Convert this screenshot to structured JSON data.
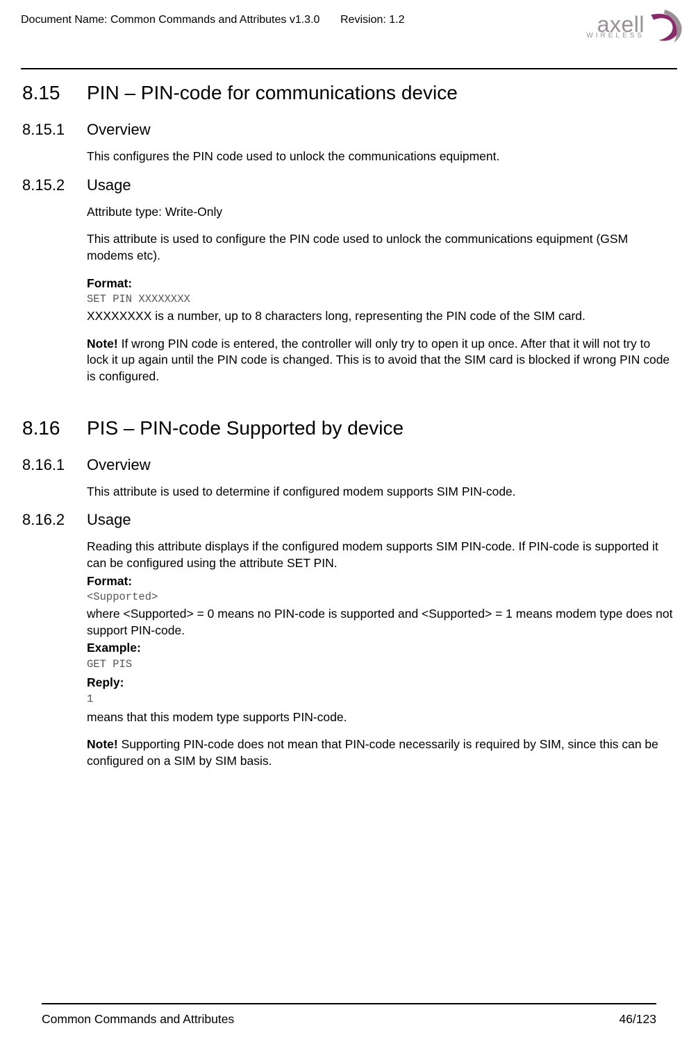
{
  "header": {
    "doc_name": "Document Name: Common Commands and Attributes v1.3.0",
    "revision": "Revision: 1.2",
    "logo_main": "axell",
    "logo_sub": "WIRELESS"
  },
  "sections": {
    "s815": {
      "num": "8.15",
      "title": "PIN – PIN-code for communications device"
    },
    "s8151": {
      "num": "8.15.1",
      "title": "Overview",
      "p1": "This configures the PIN code used to unlock the communications equipment."
    },
    "s8152": {
      "num": "8.15.2",
      "title": "Usage",
      "p1": "Attribute type: Write-Only",
      "p2": "This attribute is used to configure the PIN code used to unlock the communications equipment (GSM modems etc).",
      "format_label": "Format:",
      "format_code": "SET PIN XXXXXXXX",
      "p3": "XXXXXXXX is a number, up to 8 characters long, representing the PIN code of the SIM card.",
      "note_label": "Note!",
      "note_text": " If wrong PIN code is entered, the controller will only try to open it up once. After that it will not try to lock it up again until the PIN code is changed. This is to avoid that the SIM card is blocked if wrong PIN code is configured."
    },
    "s816": {
      "num": "8.16",
      "title": "PIS – PIN-code Supported by device"
    },
    "s8161": {
      "num": "8.16.1",
      "title": "Overview",
      "p1": "This attribute is used to determine if configured modem supports SIM PIN-code."
    },
    "s8162": {
      "num": "8.16.2",
      "title": "Usage",
      "p1": "Reading this attribute displays if the configured modem supports SIM PIN-code. If PIN-code is supported it can be configured using the attribute SET PIN.",
      "format_label": "Format:",
      "format_code": "<Supported>",
      "p2": "where <Supported> = 0 means no PIN-code is supported and <Supported> = 1 means modem type does not support PIN-code.",
      "example_label": "Example:",
      "example_code": "GET PIS",
      "reply_label": "Reply:",
      "reply_code": "1",
      "p3": "means that this modem type supports PIN-code.",
      "note_label": "Note!",
      "note_text": " Supporting PIN-code does not mean that PIN-code necessarily is required by SIM, since this can be configured on a SIM by SIM basis."
    }
  },
  "footer": {
    "left": "Common Commands and Attributes",
    "right": "46/123"
  }
}
